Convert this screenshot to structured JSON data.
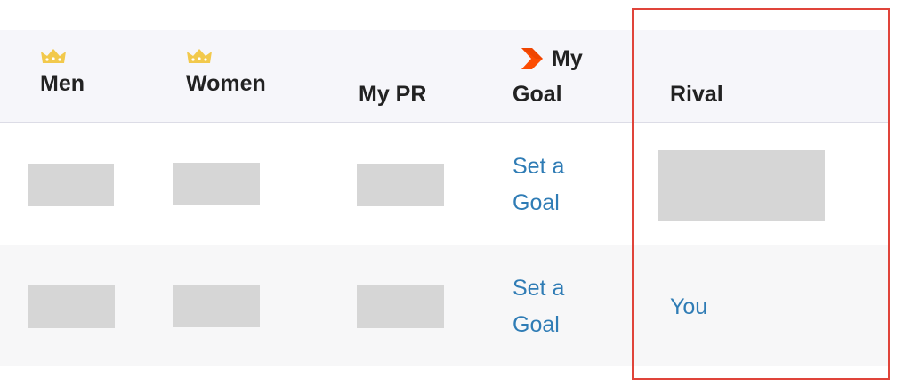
{
  "header": {
    "men_label": "Men",
    "women_label": "Women",
    "pr_label": "My PR",
    "goal_label_line1": "My",
    "goal_label_line2": "Goal",
    "rival_label": "Rival"
  },
  "rows": [
    {
      "goal_link_line1": "Set a",
      "goal_link_line2": "Goal",
      "rival_value": ""
    },
    {
      "goal_link_line1": "Set a",
      "goal_link_line2": "Goal",
      "rival_value": "You"
    }
  ],
  "icons": {
    "crown": "crown-icon",
    "goal": "chevron-right-icon"
  },
  "colors": {
    "header_bg": "#f6f6fa",
    "crown": "#f2c94c",
    "goal_chevron": "#fc4c02",
    "link": "#2f7cb5",
    "placeholder": "#d6d6d6",
    "highlight": "#e0443a"
  }
}
